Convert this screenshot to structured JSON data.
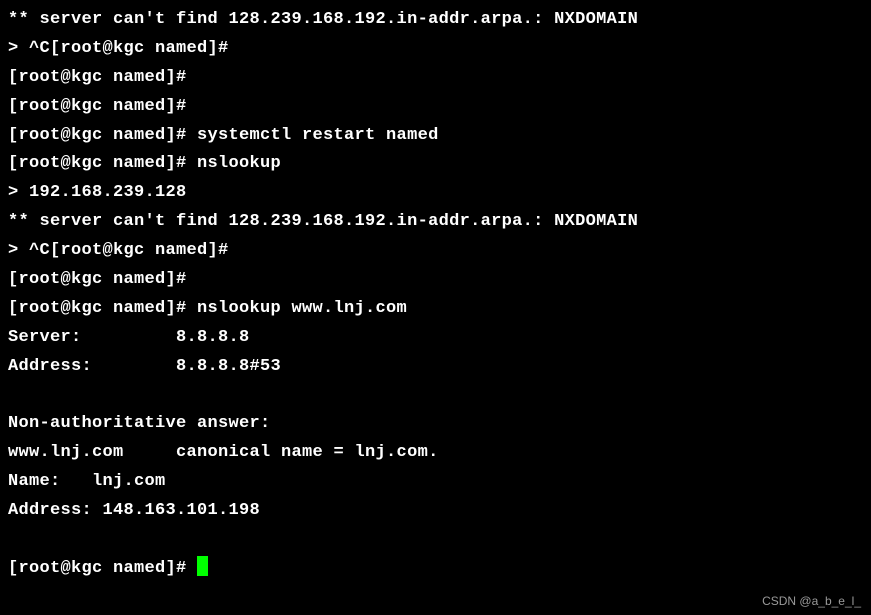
{
  "lines": {
    "l1": "** server can't find 128.239.168.192.in-addr.arpa.: NXDOMAIN",
    "l2": "> ^C[root@kgc named]#",
    "l3": "[root@kgc named]#",
    "l4": "[root@kgc named]#",
    "l5": "[root@kgc named]# systemctl restart named",
    "l6": "[root@kgc named]# nslookup",
    "l7": "> 192.168.239.128",
    "l8": "** server can't find 128.239.168.192.in-addr.arpa.: NXDOMAIN",
    "l9": "> ^C[root@kgc named]#",
    "l10": "[root@kgc named]#",
    "l11": "[root@kgc named]# nslookup www.lnj.com",
    "l12": "Server:         8.8.8.8",
    "l13": "Address:        8.8.8.8#53",
    "l14": "Non-authoritative answer:",
    "l15": "www.lnj.com     canonical name = lnj.com.",
    "l16": "Name:   lnj.com",
    "l17": "Address: 148.163.101.198",
    "l18": "[root@kgc named]# "
  },
  "watermark": "CSDN @a_b_e_l_"
}
